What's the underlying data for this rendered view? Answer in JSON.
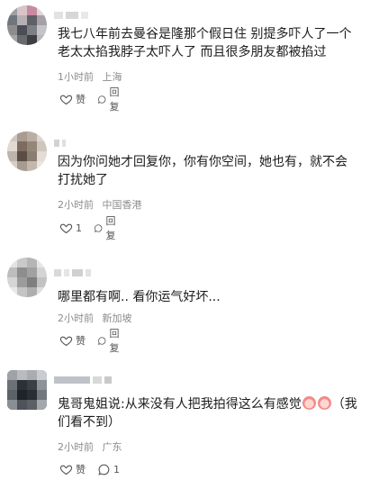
{
  "comments": [
    {
      "text": "我七八年前去曼谷是隆那个假日住 别提多吓人了一个老太太掐我脖子太吓人了 而且很多朋友都被掐过",
      "time": "1小时前",
      "location": "上海",
      "like_label": "赞",
      "reply_label": "回复"
    },
    {
      "text": "因为你问她才回复你，你有你空间，她也有，就不会打扰她了",
      "time": "2小时前",
      "location": "中国香港",
      "like_label": "1",
      "reply_label": "回复"
    },
    {
      "text": "哪里都有啊.. 看你运气好坏...",
      "time": "2小时前",
      "location": "新加坡",
      "like_label": "赞",
      "reply_label": "回复"
    },
    {
      "text_before": "鬼哥鬼姐说:从来没有人把我拍得这么有感觉",
      "text_after": "（我们看不到）",
      "time": "2小时前",
      "location": "广东",
      "like_label": "赞",
      "reply_label": "1"
    }
  ],
  "icons": {
    "like": "heart-outline-icon",
    "reply": "chat-bubble-icon",
    "emoji": "clown-face-emoji-icon"
  }
}
